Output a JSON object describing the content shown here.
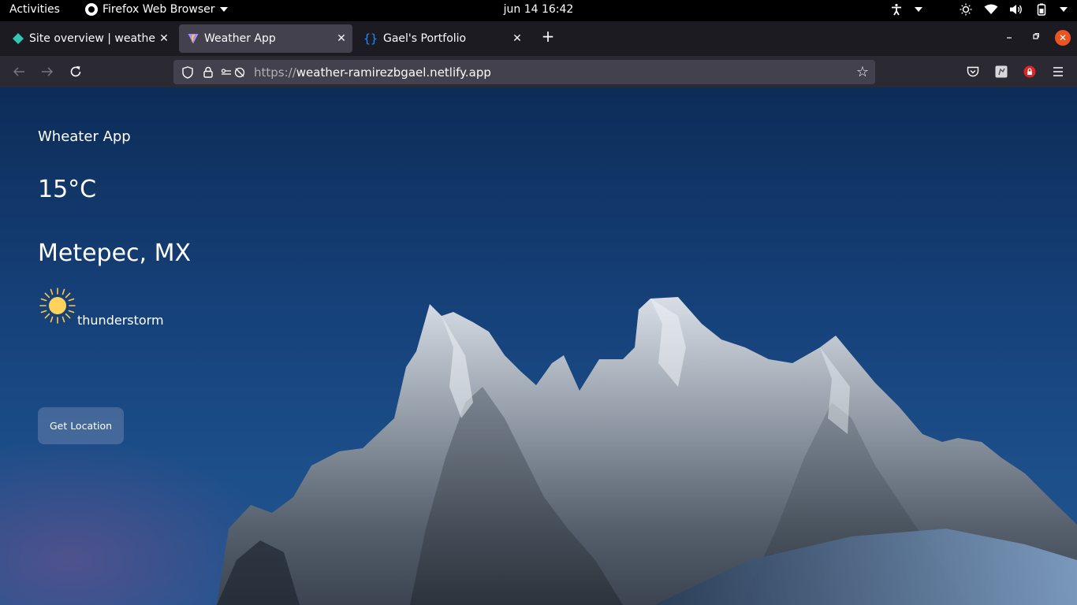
{
  "system": {
    "activities": "Activities",
    "app_menu": "Firefox Web Browser",
    "clock": "jun 14  16:42"
  },
  "tabs": [
    {
      "title": "Site overview | weather-r",
      "favicon": "netlify-icon"
    },
    {
      "title": "Weather App",
      "favicon": "vite-icon",
      "active": true
    },
    {
      "title": "Gael's Portfolio",
      "favicon": "braces-icon"
    }
  ],
  "url": {
    "scheme": "https://",
    "host": "weather-ramirezbgael.netlify.app"
  },
  "weather": {
    "app_title": "Wheater App",
    "temperature": "15°C",
    "city": "Metepec, MX",
    "condition": "thunderstorm",
    "condition_icon": "sun-icon",
    "button_label": "Get Location"
  },
  "colors": {
    "accent_close": "#e95420",
    "sun": "#ffd35b"
  }
}
